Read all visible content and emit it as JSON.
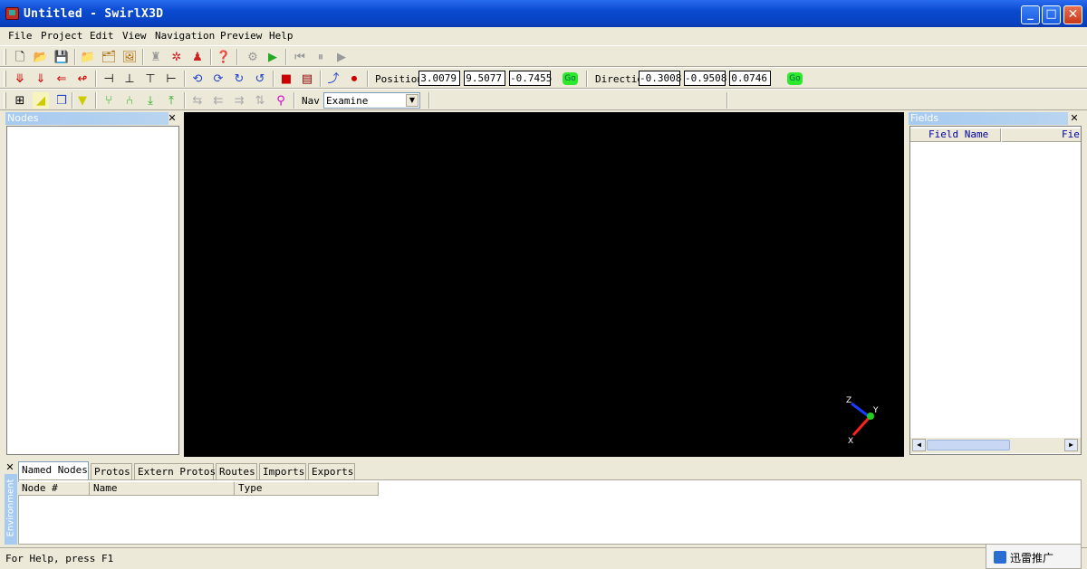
{
  "window": {
    "title": "Untitled - SwirlX3D"
  },
  "menu": [
    "File",
    "Project",
    "Edit",
    "View",
    "Navigation",
    "Preview",
    "Help"
  ],
  "toolbar": {
    "position_label": "Position",
    "position": [
      "3.0079",
      "9.5077",
      "-0.7455"
    ],
    "direction_label": "Directio",
    "direction": [
      "-0.3008",
      "-0.9508",
      "0.0746"
    ],
    "go_label": "Go",
    "nav_label": "Nav",
    "nav_value": "Examine"
  },
  "panels": {
    "nodes_title": "Nodes",
    "fields_title": "Fields",
    "fields_columns": [
      "Field Name",
      "Fie"
    ],
    "environment_title": "Environment"
  },
  "axis_gizmo": {
    "z": "Z",
    "y": "Y",
    "x": "X"
  },
  "bottom_tabs": [
    "Named Nodes",
    "Protos",
    "Extern Protos",
    "Routes",
    "Imports",
    "Exports"
  ],
  "bottom_columns": [
    "Node #",
    "Name",
    "Type"
  ],
  "status": {
    "text": "For Help, press F1",
    "tray_label": "迅雷推广"
  },
  "colors": {
    "titlebar": "#0a4ad0",
    "viewport": "#000000",
    "panel_header": "#a6caf0"
  }
}
